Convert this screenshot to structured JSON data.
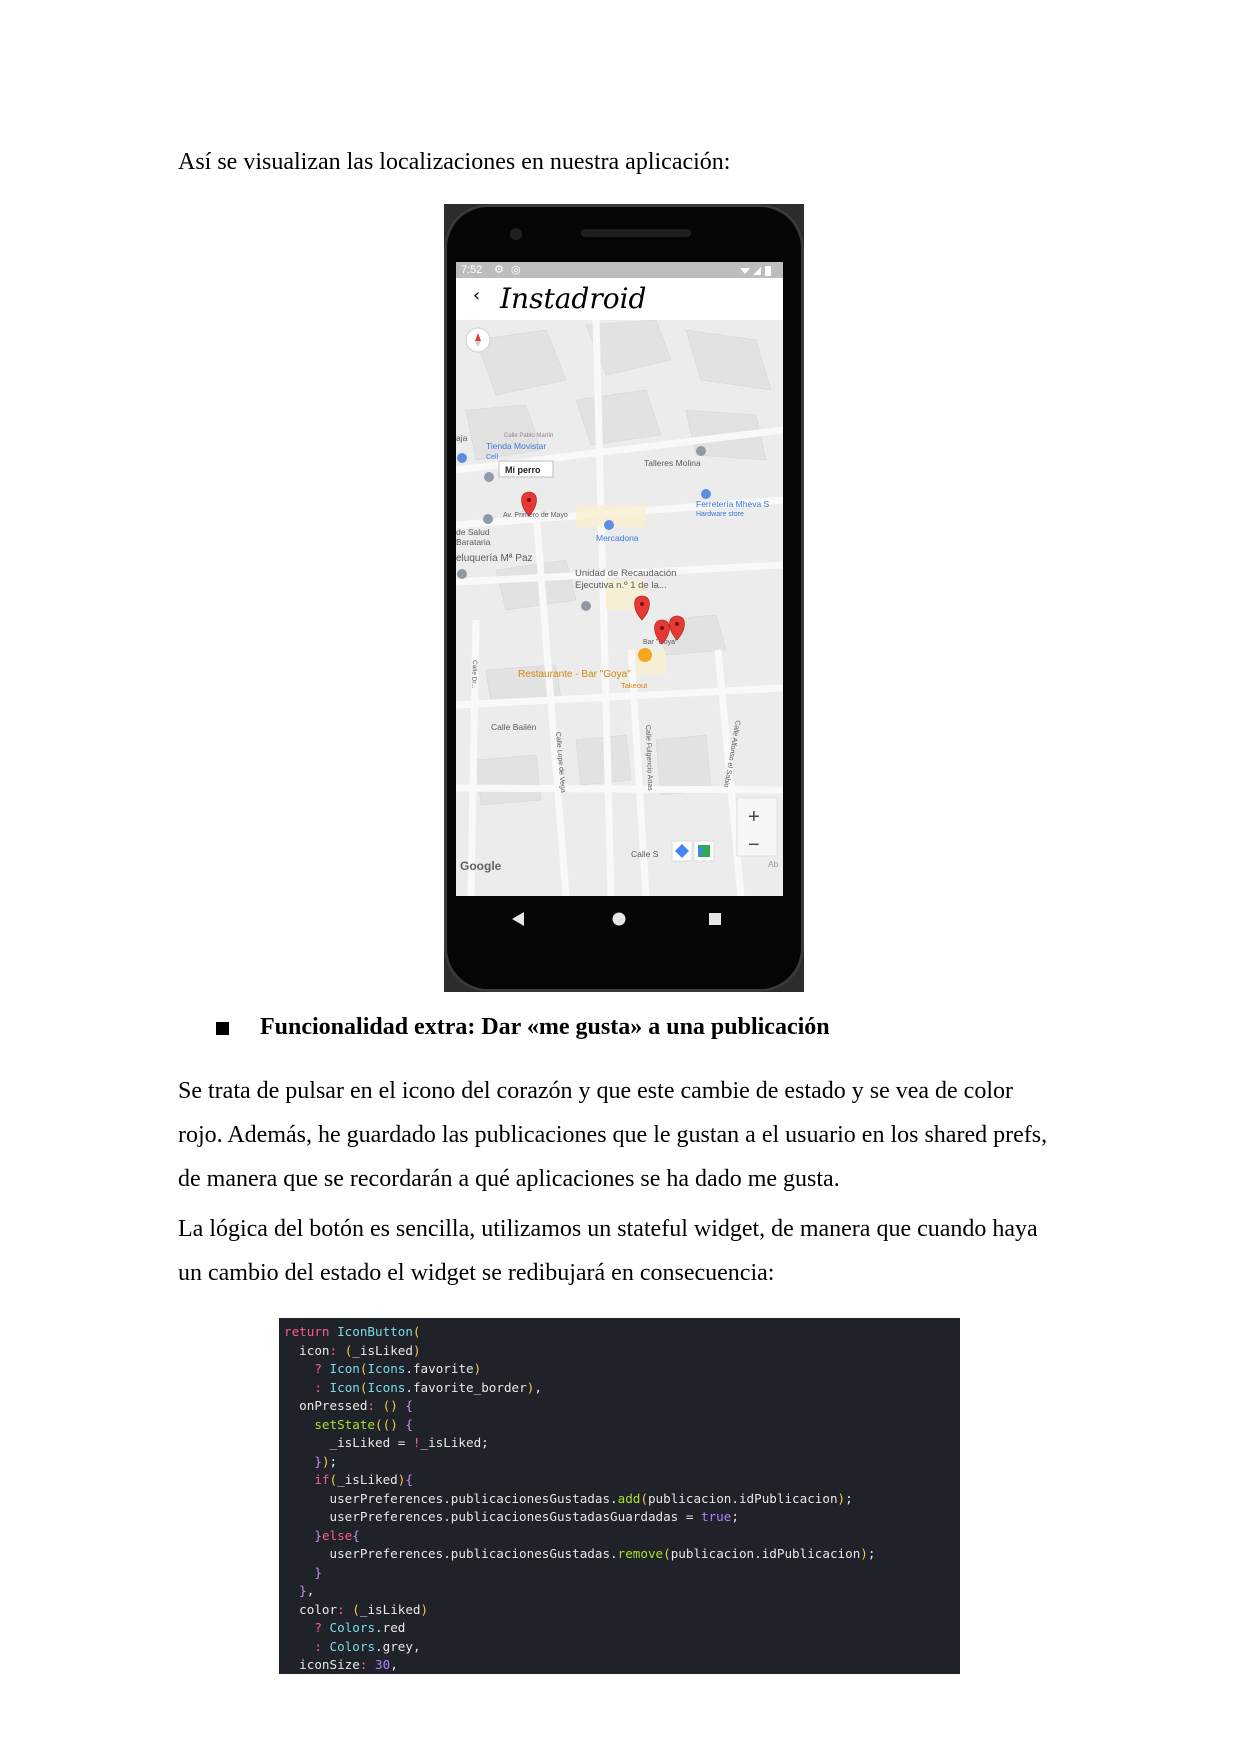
{
  "intro_text": "Así se visualizan las localizaciones en nuestra aplicación:",
  "phone": {
    "status_time": "7:52",
    "app_title": "Instadroid",
    "back_glyph": "‹",
    "map_labels": {
      "tienda": "Tienda Movistar",
      "cell": "Cell",
      "calle_pablo": "Calle Pablo Martín",
      "mi_perro": "Mi perro",
      "talleres": "Talleres Molina",
      "av_primero": "Av. Primero de Mayo",
      "ferreteria": "Ferretería Mheva S",
      "hardware": "Hardware store",
      "salud": "de Salud",
      "barataria": "Barataria",
      "mercadona": "Mercadona",
      "peluqueria": "eluquería Mª Paz",
      "unidad1": "Unidad de Recaudación",
      "unidad2": "Ejecutiva n.º 1 de la...",
      "bar_goya_small": "Bar \"Goya\"",
      "restaurante": "Restaurante - Bar \"Goya\"",
      "takeout": "Takeout",
      "calle_bailen": "Calle Bailén",
      "calle_lope": "Calle Lope de Vega",
      "calle_fulgencio": "Calle Fulgencio Arias",
      "calle_alfonso": "Calle Alfonso el Sabio",
      "calle_s": "Calle S",
      "calle_dr": "Calle Dr...",
      "ab": "Ab",
      "aja": "aja",
      "google": "Google",
      "zoom_in": "+",
      "zoom_out": "−"
    }
  },
  "section_heading": "Funcionalidad extra: Dar «me gusta» a una publicación",
  "paragraph1": {
    "line1": "Se trata de pulsar en el icono del corazón y que este cambie de estado y se vea de color",
    "line2": "rojo. Además, he guardado las publicaciones que le gustan a el usuario en los shared prefs,",
    "line3": "de manera que se recordarán a qué aplicaciones se ha dado me gusta."
  },
  "paragraph2": {
    "line1": "La lógica del botón es sencilla, utilizamos un stateful widget, de manera que cuando haya",
    "line2": "un cambio del estado el widget se redibujará en consecuencia:"
  },
  "code": {
    "l1": "return IconButton(",
    "l2": "  icon: (_isLiked)",
    "l3": "    ? Icon(Icons.favorite)",
    "l4": "    : Icon(Icons.favorite_border),",
    "l5": "  onPressed: () {",
    "l6": "    setState(() {",
    "l7": "      _isLiked = !_isLiked;",
    "l8": "    });",
    "l9": "    if(_isLiked){",
    "l10": "      userPreferences.publicacionesGustadas.add(publicacion.idPublicacion);",
    "l11": "      userPreferences.publicacionesGustadasGuardadas = true;",
    "l12": "    }else{",
    "l13": "      userPreferences.publicacionesGustadas.remove(publicacion.idPublicacion);",
    "l14": "    }",
    "l15": "  },",
    "l16": "  color: (_isLiked)",
    "l17": "    ? Colors.red",
    "l18": "    : Colors.grey,",
    "l19": "  iconSize: 30,"
  }
}
